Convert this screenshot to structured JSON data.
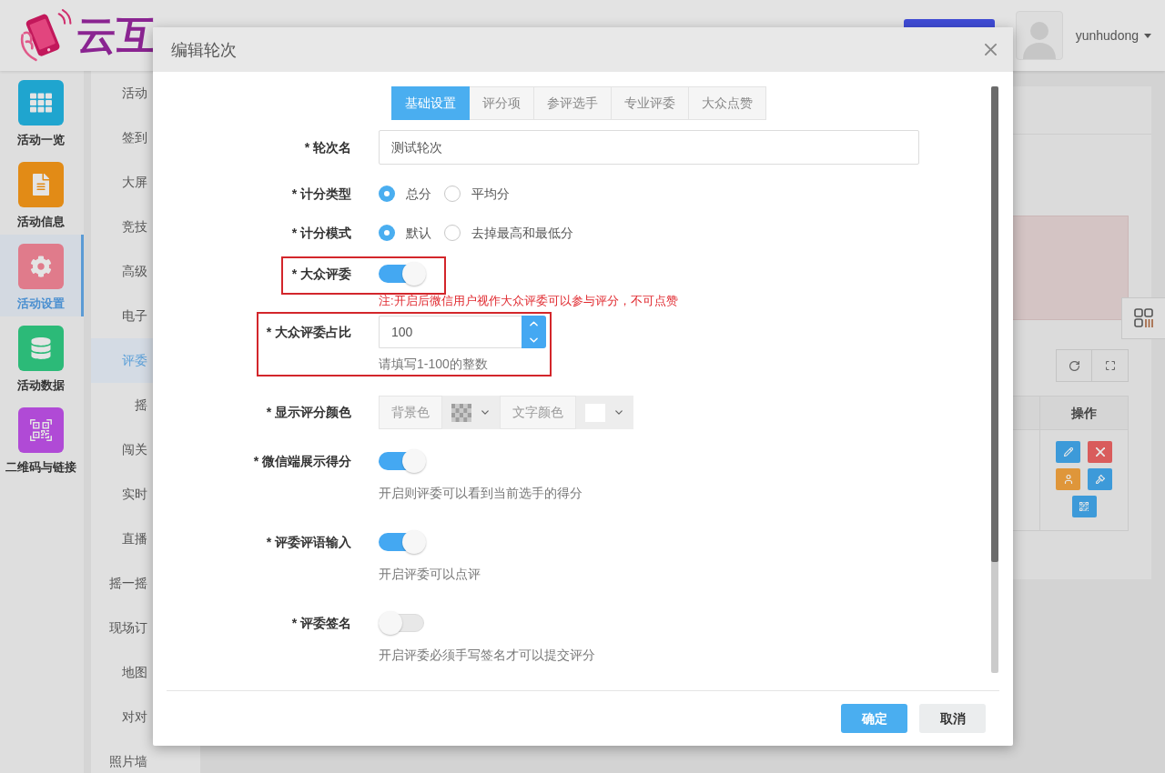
{
  "header": {
    "logo_text": "云互",
    "user": {
      "name": "yunhudong"
    }
  },
  "sidebar": {
    "items": [
      {
        "label": "活动一览",
        "color": "#1fa5cf",
        "selected": false
      },
      {
        "label": "活动信息",
        "color": "#e28b16",
        "selected": false
      },
      {
        "label": "活动设置",
        "color": "#e07b8b",
        "selected": true
      },
      {
        "label": "活动数据",
        "color": "#2cba78",
        "selected": false
      },
      {
        "label": "二维码与链接",
        "color": "#b04ad6",
        "selected": false
      }
    ]
  },
  "submenu": {
    "items": [
      {
        "label": "活动",
        "selected": false
      },
      {
        "label": "签到",
        "selected": false
      },
      {
        "label": "大屏",
        "selected": false
      },
      {
        "label": "竞技",
        "selected": false
      },
      {
        "label": "高级",
        "selected": false
      },
      {
        "label": "电子",
        "selected": false
      },
      {
        "label": "评委",
        "selected": true
      },
      {
        "label": "摇",
        "selected": false
      },
      {
        "label": "闯关",
        "selected": false
      },
      {
        "label": "实时",
        "selected": false
      },
      {
        "label": "直播",
        "selected": false
      },
      {
        "label": "摇一摇",
        "selected": false
      },
      {
        "label": "现场订",
        "selected": false
      },
      {
        "label": "地图",
        "selected": false
      },
      {
        "label": "对对",
        "selected": false
      },
      {
        "label": "照片墙",
        "selected": false
      }
    ]
  },
  "main": {
    "table": {
      "columns": [
        "操作"
      ]
    }
  },
  "modal": {
    "title": "编辑轮次",
    "tabs": [
      {
        "label": "基础设置",
        "selected": true
      },
      {
        "label": "评分项",
        "selected": false
      },
      {
        "label": "参评选手",
        "selected": false
      },
      {
        "label": "专业评委",
        "selected": false
      },
      {
        "label": "大众点赞",
        "selected": false
      }
    ],
    "form": {
      "rows": [
        {
          "kind": "text",
          "label": "* 轮次名",
          "value": "测试轮次",
          "highlighted": false
        },
        {
          "kind": "radio",
          "label": "* 计分类型",
          "options": [
            {
              "label": "总分",
              "selected": true
            },
            {
              "label": "平均分",
              "selected": false
            }
          ],
          "highlighted": false
        },
        {
          "kind": "radio",
          "label": "* 计分模式",
          "options": [
            {
              "label": "默认",
              "selected": true
            },
            {
              "label": "去掉最高和最低分",
              "selected": false
            }
          ],
          "highlighted": false
        },
        {
          "kind": "toggle",
          "label": "* 大众评委",
          "on": true,
          "note": "注:开启后微信用户视作大众评委可以参与评分，不可点赞",
          "highlighted": true
        },
        {
          "kind": "number",
          "label": "* 大众评委占比",
          "value": "100",
          "hint": "请填写1-100的整数",
          "highlighted": true
        },
        {
          "kind": "colors",
          "label": "* 显示评分颜色",
          "pickers": [
            {
              "label": "背景色",
              "kind": "transparent"
            },
            {
              "label": "文字颜色",
              "kind": "solid",
              "color": "#ffffff"
            }
          ],
          "highlighted": false
        },
        {
          "kind": "toggle",
          "label": "* 微信端展示得分",
          "on": true,
          "hint": "开启则评委可以看到当前选手的得分",
          "highlighted": false
        },
        {
          "kind": "toggle",
          "label": "* 评委评语输入",
          "on": true,
          "hint": "开启评委可以点评",
          "highlighted": false
        },
        {
          "kind": "toggle",
          "label": "* 评委签名",
          "on": false,
          "hint": "开启评委必须手写签名才可以提交评分",
          "highlighted": false
        }
      ]
    },
    "buttons": [
      {
        "label": "确定",
        "kind": "primary"
      },
      {
        "label": "取消",
        "kind": "default"
      }
    ]
  }
}
